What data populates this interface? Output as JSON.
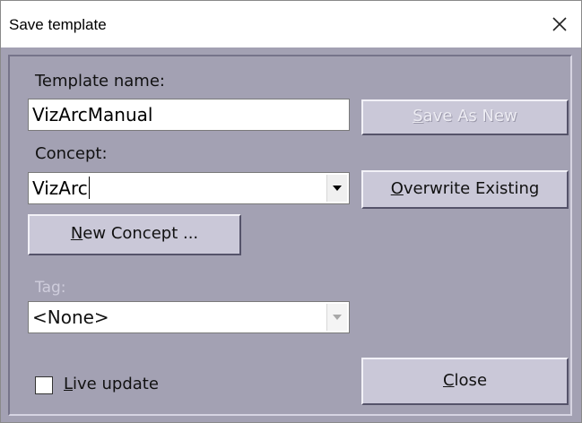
{
  "window": {
    "title": "Save template",
    "close_glyph": "✕"
  },
  "form": {
    "template_name_label": "Template name:",
    "template_name_value": "VizArcManual",
    "concept_label": "Concept:",
    "concept_value": "VizArc",
    "tag_label": "Tag:",
    "tag_value": "<None>"
  },
  "buttons": {
    "save_as_new": {
      "mnemonic": "S",
      "rest": "ave As New",
      "enabled": false
    },
    "overwrite_existing": {
      "mnemonic": "O",
      "rest": "verwrite Existing",
      "enabled": true
    },
    "new_concept": {
      "mnemonic": "N",
      "rest": "ew Concept ...",
      "enabled": true
    },
    "close": {
      "mnemonic": "C",
      "rest": "lose",
      "enabled": true
    }
  },
  "live_update": {
    "mnemonic": "L",
    "rest": "ive update",
    "checked": false
  },
  "icons": {
    "close": "close-icon",
    "dropdown": "chevron-down-icon"
  },
  "colors": {
    "client_background": "#a3a1b3",
    "button_face": "#cac8d8",
    "disabled_text": "#cfcddc"
  }
}
